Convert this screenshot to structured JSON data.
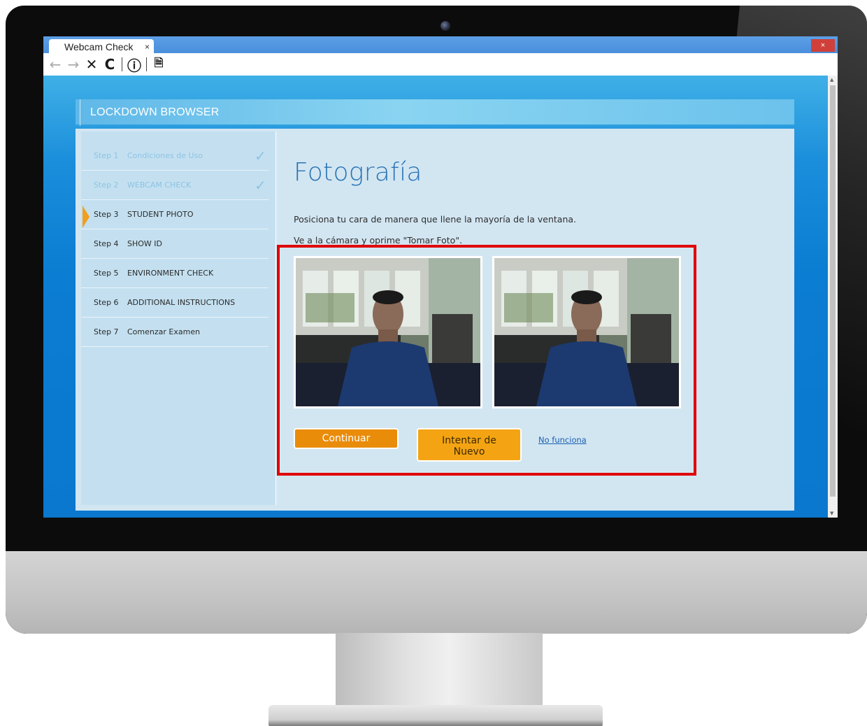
{
  "browser": {
    "tab_title": "Webcam Check",
    "tab_close": "×",
    "window_close": "×"
  },
  "toolbar": {
    "back_icon": "←",
    "forward_icon": "→",
    "stop_icon": "✕",
    "reload_icon": "C",
    "info_icon": "ⓘ",
    "pdf_icon": "🗎"
  },
  "app": {
    "title": "LOCKDOWN BROWSER"
  },
  "steps": [
    {
      "num": "Step 1",
      "label": "Condiciones de Uso",
      "done": true
    },
    {
      "num": "Step 2",
      "label": "WEBCAM CHECK",
      "done": true
    },
    {
      "num": "Step 3",
      "label": "STUDENT PHOTO",
      "active": true
    },
    {
      "num": "Step 4",
      "label": "SHOW ID"
    },
    {
      "num": "Step 5",
      "label": "ENVIRONMENT CHECK"
    },
    {
      "num": "Step 6",
      "label": "ADDITIONAL INSTRUCTIONS"
    },
    {
      "num": "Step 7",
      "label": "Comenzar Examen"
    }
  ],
  "check_glyph": "✓",
  "main": {
    "heading": "Fotografía",
    "instruction_1": "Posiciona tu cara de manera que llene la mayoría de la ventana.",
    "instruction_2": "Ve a la cámara y oprime \"Tomar Foto\".",
    "continue_button": "Continuar",
    "retry_button_line1": "Intentar de",
    "retry_button_line2": "Nuevo",
    "not_working_link": "No funciona"
  },
  "colors": {
    "accent_orange": "#e98c0a",
    "highlight_red": "#e00000",
    "heading_blue": "#2a73b3"
  }
}
